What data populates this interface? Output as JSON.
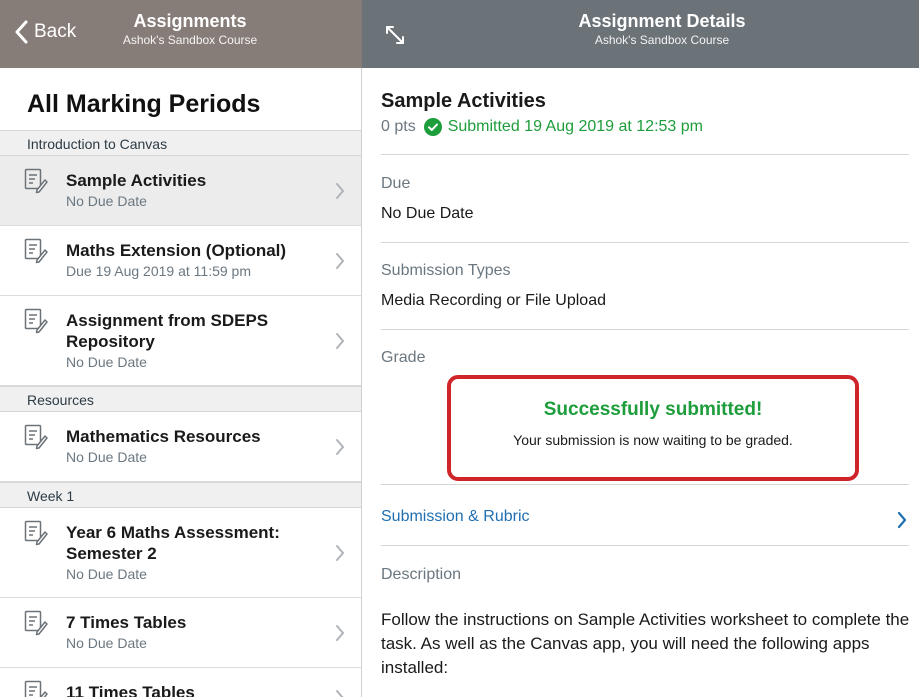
{
  "nav_left": {
    "back_label": "Back",
    "title": "Assignments",
    "subtitle": "Ashok's Sandbox Course"
  },
  "nav_right": {
    "title": "Assignment Details",
    "subtitle": "Ashok's Sandbox Course"
  },
  "list": {
    "heading": "All Marking Periods",
    "groups": [
      {
        "name": "Introduction to Canvas",
        "items": [
          {
            "name": "Sample Activities",
            "sub": "No Due Date",
            "selected": true
          },
          {
            "name": "Maths Extension (Optional)",
            "sub": "Due 19 Aug 2019 at 11:59 pm"
          },
          {
            "name": "Assignment from SDEPS Repository",
            "sub": "No Due Date"
          }
        ]
      },
      {
        "name": "Resources",
        "items": [
          {
            "name": "Mathematics Resources",
            "sub": "No Due Date"
          }
        ]
      },
      {
        "name": "Week 1",
        "items": [
          {
            "name": "Year 6 Maths Assessment: Semester 2",
            "sub": "No Due Date"
          },
          {
            "name": "7 Times Tables",
            "sub": "No Due Date"
          },
          {
            "name": "11 Times Tables",
            "sub": ""
          }
        ]
      }
    ]
  },
  "detail": {
    "title": "Sample Activities",
    "points": "0 pts",
    "submitted": "Submitted 19 Aug 2019 at 12:53 pm",
    "due_label": "Due",
    "due_value": "No Due Date",
    "types_label": "Submission Types",
    "types_value": "Media Recording or File Upload",
    "grade_label": "Grade",
    "success_title": "Successfully submitted!",
    "success_text": "Your submission is now waiting to be graded.",
    "rubric_link": "Submission & Rubric",
    "description_label": "Description",
    "description_text": "Follow the instructions on Sample Activities worksheet to complete the task. As well as the Canvas app, you will need the following apps installed:"
  },
  "colors": {
    "left_bar": "#877d78",
    "right_bar": "#6b7278",
    "success_green": "#1d9d3b",
    "link_blue": "#1f6fb2",
    "highlight_red": "#d0242b"
  },
  "icons": [
    "chevron-left-icon",
    "expand-icon",
    "assignment-icon",
    "chevron-right-icon",
    "check-circle-icon"
  ]
}
